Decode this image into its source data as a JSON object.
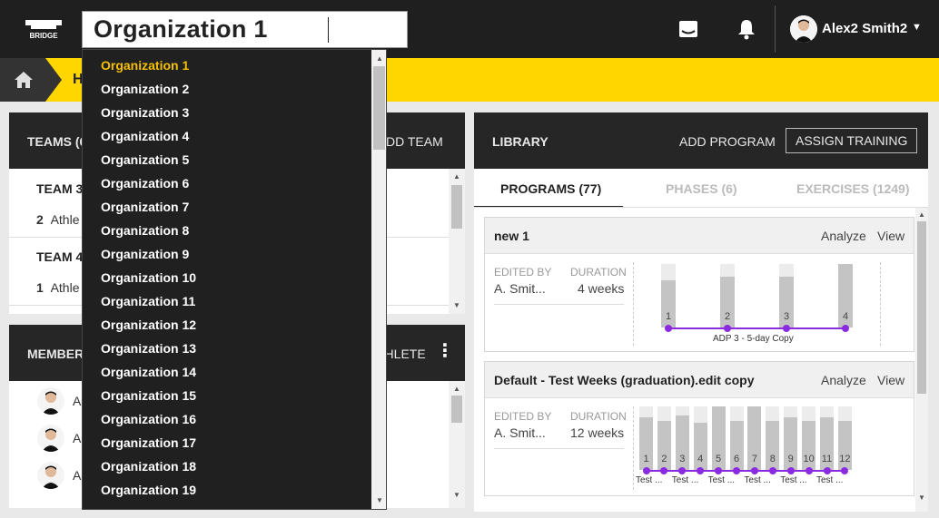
{
  "header": {
    "logo_text": "BRIDGE",
    "search_value_left": "Organization",
    "search_value_right": "1",
    "icons": [
      "inbox-icon",
      "bell-icon",
      "chevron-down-icon"
    ],
    "user_name": "Alex2 Smith2"
  },
  "breadcrumb": {
    "home_icon": "home-icon",
    "current": "H"
  },
  "teams_panel": {
    "title": "TEAMS (6",
    "action": "DD TEAM",
    "rows": [
      {
        "name": "TEAM 3",
        "count": "2",
        "sub": "Athle"
      },
      {
        "name": "TEAM 4",
        "count": "1",
        "sub": "Athle"
      }
    ]
  },
  "members_panel": {
    "title": "MEMBER",
    "action": "THLETE",
    "avatar_initials": [
      "A",
      "A",
      "A"
    ]
  },
  "library": {
    "title": "LIBRARY",
    "add_program": "ADD PROGRAM",
    "assign_training": "ASSIGN TRAINING",
    "tabs": [
      {
        "label": "PROGRAMS (77)",
        "active": true
      },
      {
        "label": "PHASES (6)",
        "active": false
      },
      {
        "label": "EXERCISES (1249)",
        "active": false
      }
    ],
    "cards": [
      {
        "title": "new 1",
        "analyze": "Analyze",
        "view": "View",
        "edited_by_label": "EDITED BY",
        "edited_by": "A. Smit...",
        "duration_label": "DURATION",
        "duration": "4 weeks",
        "weeks": [
          "1",
          "2",
          "3",
          "4"
        ],
        "phase_label": "ADP 3 - 5-day Copy"
      },
      {
        "title": "Default - Test Weeks (graduation).edit copy",
        "analyze": "Analyze",
        "view": "View",
        "edited_by_label": "EDITED BY",
        "edited_by": "A. Smit...",
        "duration_label": "DURATION",
        "duration": "12 weeks",
        "weeks": [
          "1",
          "2",
          "3",
          "4",
          "5",
          "6",
          "7",
          "8",
          "9",
          "10",
          "11",
          "12"
        ],
        "phase_labels": [
          "Test ...",
          "Test ...",
          "Test ...",
          "Test ...",
          "Test ...",
          "Test ..."
        ]
      }
    ]
  },
  "dropdown": {
    "items": [
      "Organization 1",
      "Organization 2",
      "Organization 3",
      "Organization 4",
      "Organization 5",
      "Organization 6",
      "Organization 7",
      "Organization 8",
      "Organization 9",
      "Organization 10",
      "Organization 11",
      "Organization 12",
      "Organization 13",
      "Organization 14",
      "Organization 15",
      "Organization 16",
      "Organization 17",
      "Organization 18",
      "Organization 19"
    ],
    "selected": "Organization 1"
  },
  "colors": {
    "accent_yellow": "#ffd600",
    "selected_item": "#f5c000",
    "timeline_purple": "#8a2be2",
    "header_dark": "#1f1f1f"
  }
}
